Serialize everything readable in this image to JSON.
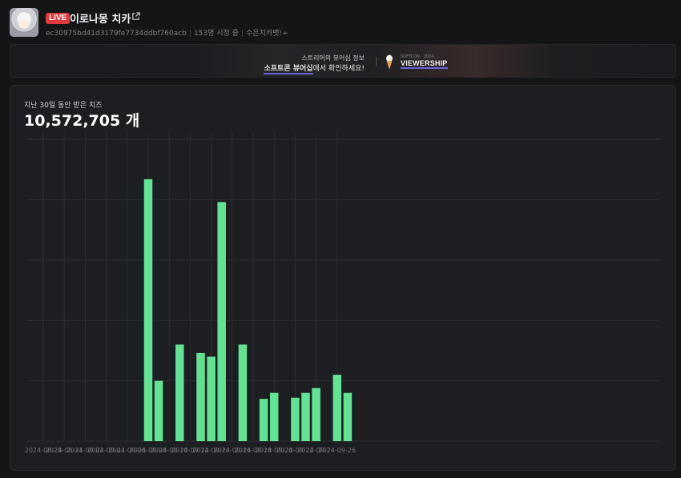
{
  "header": {
    "live_label": "LIVE",
    "channel_name": "이로나몽 치카",
    "channel_id": "ec30975bd41d3179fe7734ddbf760acb",
    "viewers": "153명 시청 중",
    "tag": "수은치카뱃!+"
  },
  "banner": {
    "line1": "스트리머의 뷰어십 정보",
    "line2_highlight": "소프트콘 뷰어십",
    "line2_rest": "에서 확인하세요!",
    "brand_small": "SOFTCON · 2024",
    "brand": "VIEWERSHIP"
  },
  "card": {
    "label": "지난 30일 동안 받은 치즈",
    "total": "10,572,705 개"
  },
  "chart_data": {
    "type": "bar",
    "x": [
      "2024-08-29",
      "2024-08-30",
      "2024-08-31",
      "2024-09-01",
      "2024-09-02",
      "2024-09-03",
      "2024-09-04",
      "2024-09-05",
      "2024-09-06",
      "2024-09-07",
      "2024-09-08",
      "2024-09-09",
      "2024-09-10",
      "2024-09-11",
      "2024-09-12",
      "2024-09-13",
      "2024-09-14",
      "2024-09-15",
      "2024-09-16",
      "2024-09-17",
      "2024-09-18",
      "2024-09-19",
      "2024-09-20",
      "2024-09-21",
      "2024-09-22",
      "2024-09-23",
      "2024-09-24",
      "2024-09-25",
      "2024-09-26",
      "2024-09-27"
    ],
    "values": [
      0,
      0,
      0,
      0,
      0,
      0,
      0,
      0,
      0,
      0,
      2170000,
      500000,
      0,
      800000,
      0,
      730000,
      700000,
      1980000,
      0,
      800000,
      0,
      350000,
      400000,
      0,
      360000,
      400000,
      440000,
      0,
      550000,
      400000
    ],
    "tick_labels": [
      "2024-08-29",
      "2024-08-31",
      "2024-09-02",
      "2024-09-04",
      "2024-09-06",
      "2024-09-08",
      "2024-09-10",
      "2024-09-12",
      "2024-09-14",
      "2024-09-16",
      "2024-09-18",
      "2024-09-20",
      "2024-09-22",
      "2024-09-24",
      "2024-09-26"
    ],
    "ylim": [
      0,
      2500000
    ],
    "grid": true,
    "bar_color": "#62e394"
  }
}
